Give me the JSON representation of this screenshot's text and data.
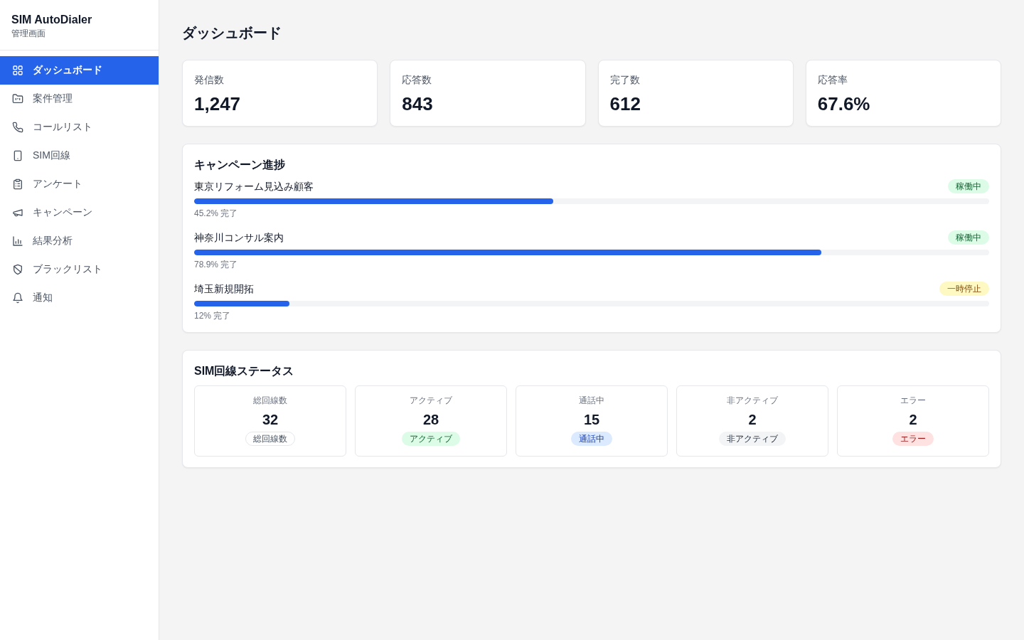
{
  "sidebar": {
    "title": "SIM AutoDialer",
    "subtitle": "管理画面",
    "items": [
      {
        "label": "ダッシュボード",
        "selected": true
      },
      {
        "label": "案件管理",
        "selected": false
      },
      {
        "label": "コールリスト",
        "selected": false
      },
      {
        "label": "SIM回線",
        "selected": false
      },
      {
        "label": "アンケート",
        "selected": false
      },
      {
        "label": "キャンペーン",
        "selected": false
      },
      {
        "label": "結果分析",
        "selected": false
      },
      {
        "label": "ブラックリスト",
        "selected": false
      },
      {
        "label": "通知",
        "selected": false
      }
    ]
  },
  "page_title": "ダッシュボード",
  "stats": [
    {
      "label": "発信数",
      "value": "1,247"
    },
    {
      "label": "応答数",
      "value": "843"
    },
    {
      "label": "完了数",
      "value": "612"
    },
    {
      "label": "応答率",
      "value": "67.6%"
    }
  ],
  "campaign_progress": {
    "title": "キャンペーン進捗",
    "items": [
      {
        "name": "東京リフォーム見込み顧客",
        "status": "稼働中",
        "kind": "running",
        "level": 0.452,
        "progress_text": "45.2% 完了"
      },
      {
        "name": "神奈川コンサル案内",
        "status": "稼働中",
        "kind": "running",
        "level": 0.789,
        "progress_text": "78.9% 完了"
      },
      {
        "name": "埼玉新規開拓",
        "status": "一時停止",
        "kind": "paused",
        "level": 0.12,
        "progress_text": "12% 完了"
      }
    ]
  },
  "sim_status": {
    "title": "SIM回線ステータス",
    "items": [
      {
        "label": "総回線数",
        "value": "32",
        "badge": "総回線数",
        "kind": "total"
      },
      {
        "label": "アクティブ",
        "value": "28",
        "badge": "アクティブ",
        "kind": "active"
      },
      {
        "label": "通話中",
        "value": "15",
        "badge": "通話中",
        "kind": "calling"
      },
      {
        "label": "非アクティブ",
        "value": "2",
        "badge": "非アクティブ",
        "kind": "inactive"
      },
      {
        "label": "エラー",
        "value": "2",
        "badge": "エラー",
        "kind": "error"
      }
    ]
  }
}
